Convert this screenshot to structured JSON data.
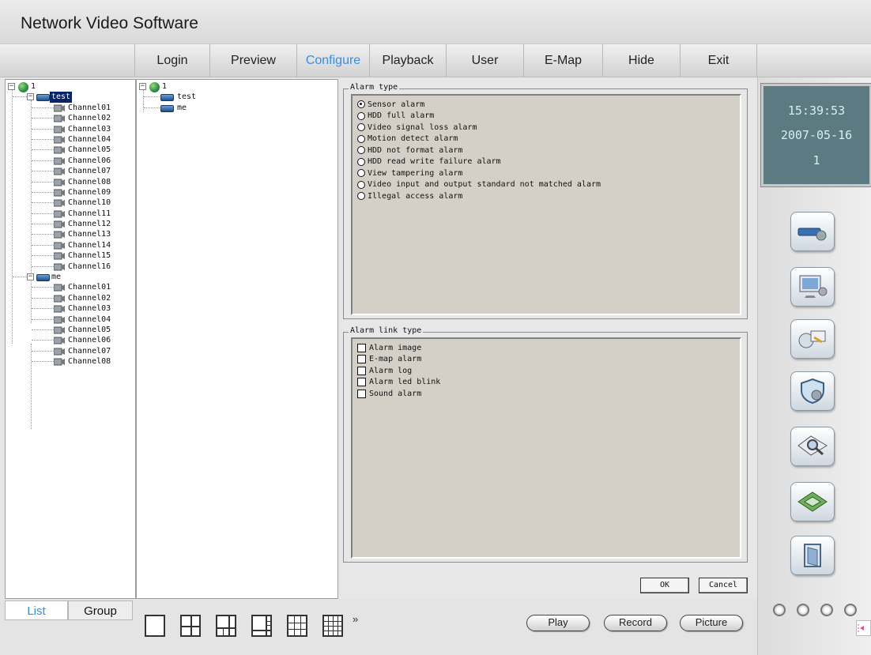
{
  "app": {
    "title": "Network Video Software"
  },
  "nav": {
    "items": [
      {
        "label": "Login"
      },
      {
        "label": "Preview"
      },
      {
        "label": "Configure"
      },
      {
        "label": "Playback"
      },
      {
        "label": "User"
      },
      {
        "label": "E-Map"
      },
      {
        "label": "Hide"
      },
      {
        "label": "Exit"
      }
    ],
    "active": "Configure",
    "accent": "#3b8de0"
  },
  "device_tree": {
    "root": "1",
    "devices": [
      {
        "name": "test",
        "selected": true,
        "channels": [
          "Channel01",
          "Channel02",
          "Channel03",
          "Channel04",
          "Channel05",
          "Channel06",
          "Channel07",
          "Channel08",
          "Channel09",
          "Channel10",
          "Channel11",
          "Channel12",
          "Channel13",
          "Channel14",
          "Channel15",
          "Channel16"
        ]
      },
      {
        "name": "me",
        "selected": false,
        "channels": [
          "Channel01",
          "Channel02",
          "Channel03",
          "Channel04",
          "Channel05",
          "Channel06",
          "Channel07",
          "Channel08"
        ]
      }
    ]
  },
  "group_tree": {
    "root": "1",
    "items": [
      "test",
      "me"
    ]
  },
  "alarm_type": {
    "legend": "Alarm type",
    "options": [
      "Sensor alarm",
      "HDD full alarm",
      "Video signal loss alarm",
      "Motion detect alarm",
      "HDD not format alarm",
      "HDD read write failure alarm",
      "View tampering alarm",
      "Video input and output standard not matched alarm",
      "Illegal access alarm"
    ],
    "selected_index": 0
  },
  "alarm_link": {
    "legend": "Alarm link type",
    "options": [
      "Alarm image",
      "E-map alarm",
      "Alarm log",
      "Alarm led blink",
      "Sound alarm"
    ]
  },
  "dialog_buttons": {
    "ok": "OK",
    "cancel": "Cancel"
  },
  "clock": {
    "time": "15:39:53",
    "date": "2007-05-16",
    "value": "1"
  },
  "bottom_tabs": {
    "list": "List",
    "group": "Group",
    "active": "List"
  },
  "layout_buttons": [
    "layout-1-icon",
    "layout-4-icon",
    "layout-6-icon",
    "layout-8-icon",
    "layout-9-icon",
    "layout-16-icon"
  ],
  "more_label": "»",
  "actions": {
    "play": "Play",
    "record": "Record",
    "picture": "Picture"
  },
  "side_buttons": [
    "device-config-icon",
    "monitor-config-icon",
    "network-config-icon",
    "security-config-icon",
    "search-icon",
    "card-icon",
    "exit-door-icon"
  ]
}
